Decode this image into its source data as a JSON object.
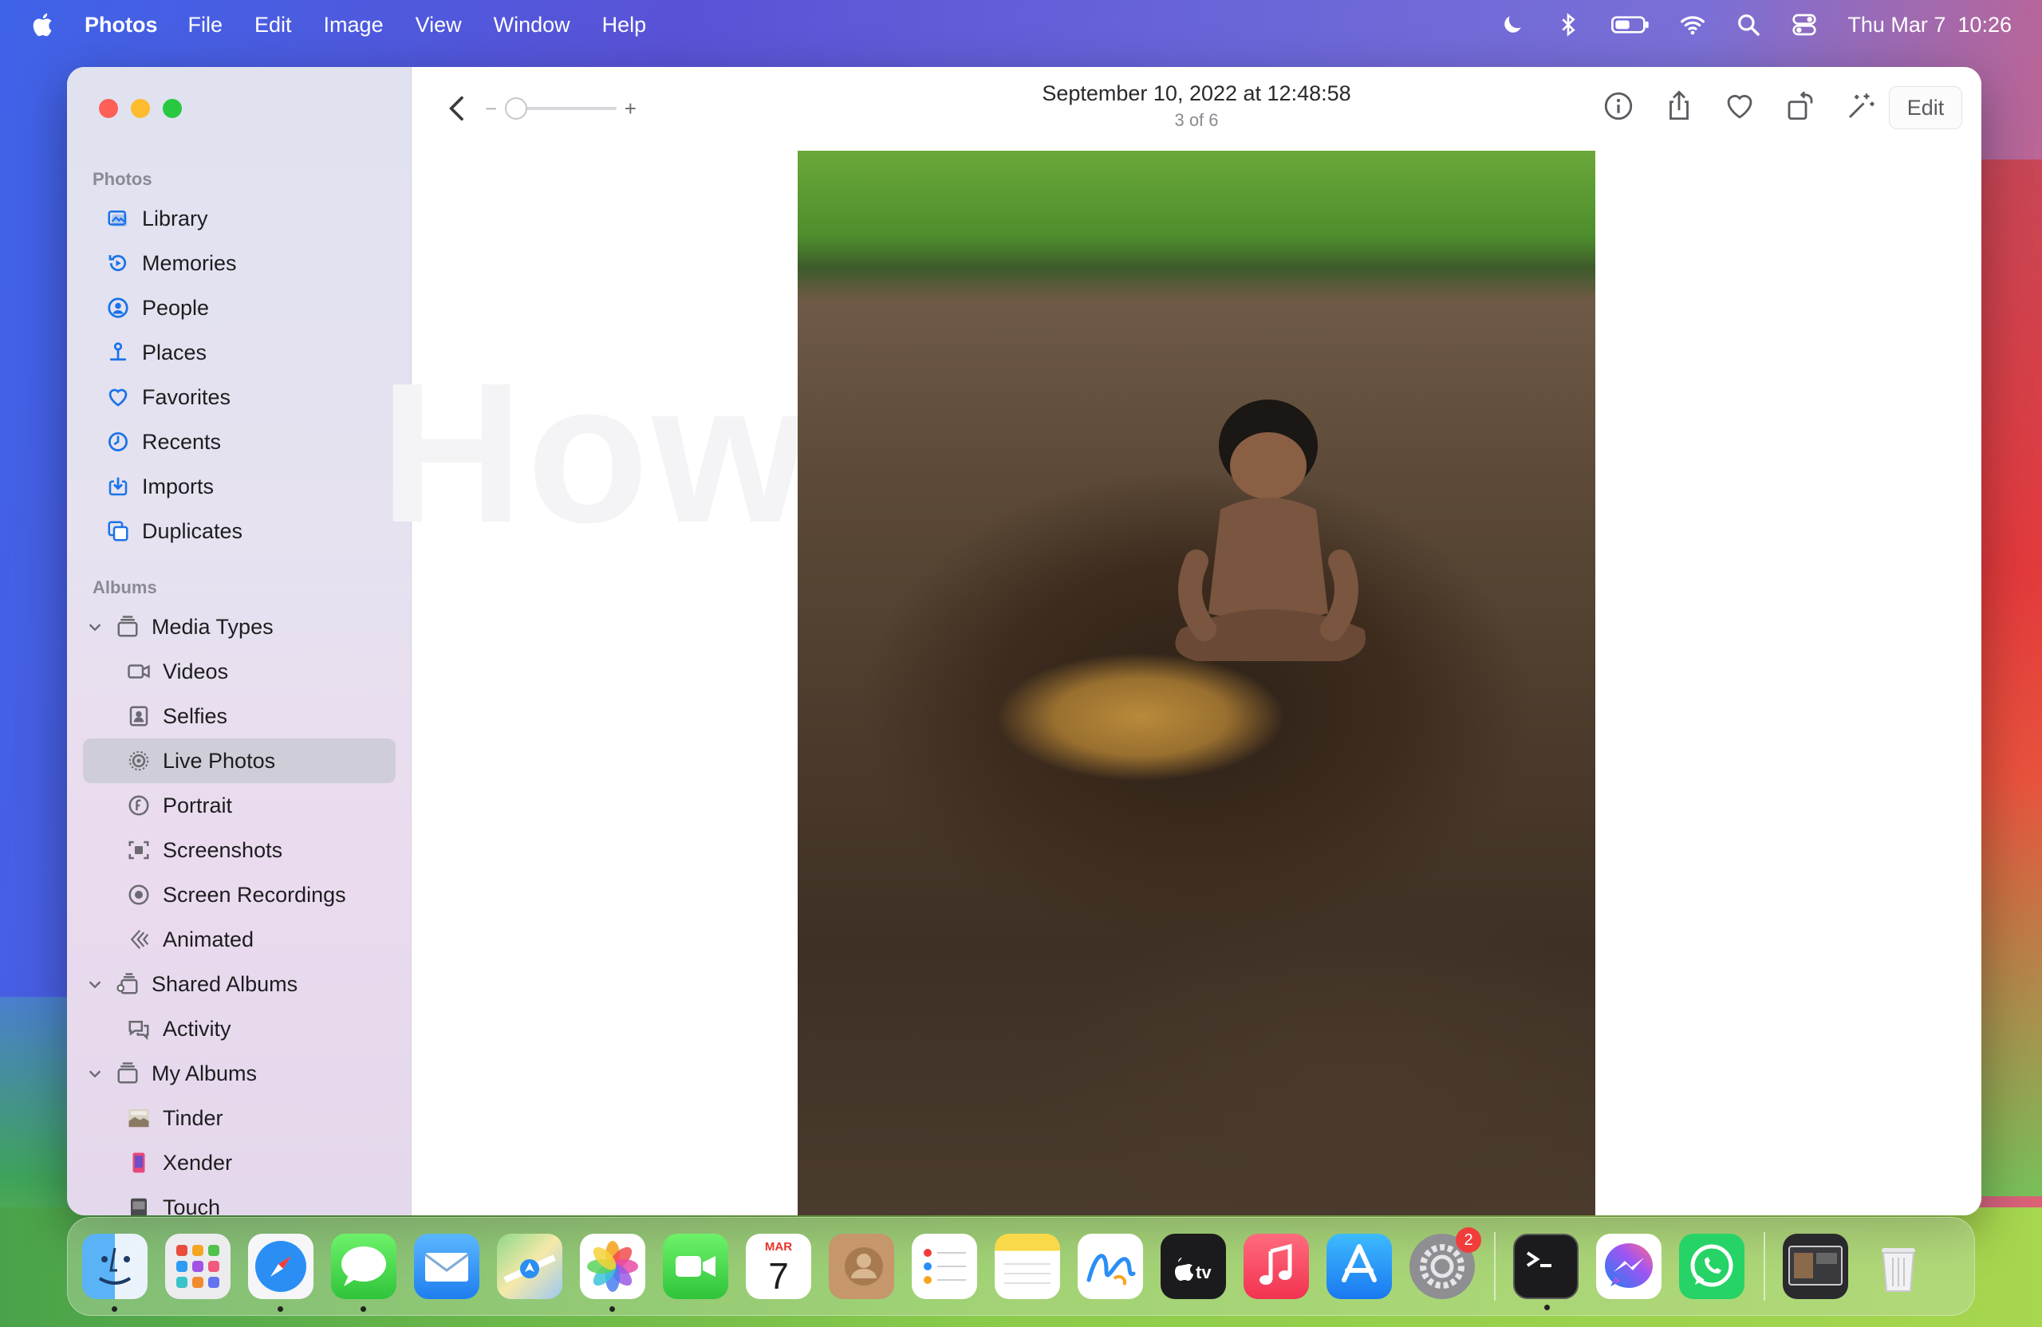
{
  "menubar": {
    "app_name": "Photos",
    "menus": [
      "File",
      "Edit",
      "Image",
      "View",
      "Window",
      "Help"
    ],
    "clock": "Thu Mar 7  10:26"
  },
  "sidebar": {
    "section_photos": "Photos",
    "photos_items": [
      {
        "label": "Library",
        "icon": "library-icon"
      },
      {
        "label": "Memories",
        "icon": "memories-icon"
      },
      {
        "label": "People",
        "icon": "people-icon"
      },
      {
        "label": "Places",
        "icon": "places-icon"
      },
      {
        "label": "Favorites",
        "icon": "heart-icon"
      },
      {
        "label": "Recents",
        "icon": "clock-icon"
      },
      {
        "label": "Imports",
        "icon": "import-icon"
      },
      {
        "label": "Duplicates",
        "icon": "duplicates-icon"
      }
    ],
    "section_albums": "Albums",
    "media_types": "Media Types",
    "media_items": [
      "Videos",
      "Selfies",
      "Live Photos",
      "Portrait",
      "Screenshots",
      "Screen Recordings",
      "Animated"
    ],
    "selected": "Live Photos",
    "shared_albums": "Shared Albums",
    "shared_items": [
      "Activity"
    ],
    "my_albums": "My Albums",
    "my_items": [
      "Tinder",
      "Xender",
      "Touch"
    ]
  },
  "toolbar": {
    "title": "September 10, 2022 at 12:48:58",
    "subtitle": "3 of 6",
    "zoom_minus": "−",
    "zoom_plus": "+",
    "edit_label": "Edit"
  },
  "watermark": "HowTo",
  "dock": {
    "calendar_month": "MAR",
    "calendar_day": "7",
    "settings_badge": "2"
  },
  "colors": {
    "accent": "#1a73e8",
    "selection": "#cfcdd8"
  }
}
